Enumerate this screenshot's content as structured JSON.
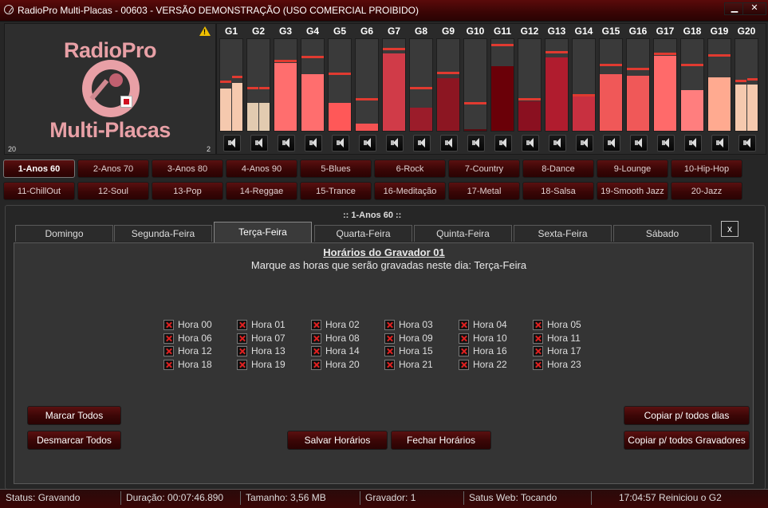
{
  "window": {
    "title": "RadioPro Multi-Placas - 00603 - VERSÃO DEMONSTRAÇÃO (USO COMERCIAL PROIBIDO)",
    "minimize": "▁",
    "close": "✕"
  },
  "logo": {
    "line1": "RadioPro",
    "line2": "Multi-Placas",
    "left_num": "20",
    "right_num": "2",
    "warn": "!"
  },
  "channels": [
    {
      "label": "G1",
      "level": 0.46,
      "peak": 0.52,
      "color": "#f5c9ae",
      "split": true,
      "level2": 0.52,
      "peak2": 0.57
    },
    {
      "label": "G2",
      "level": 0.3,
      "peak": 0.45,
      "color": "#e2cbb0",
      "split": true,
      "level2": 0.3,
      "peak2": 0.45
    },
    {
      "label": "G3",
      "level": 0.74,
      "peak": 0.75,
      "color": "#ff6e6e"
    },
    {
      "label": "G4",
      "level": 0.62,
      "peak": 0.79,
      "color": "#ff6e6e"
    },
    {
      "label": "G5",
      "level": 0.3,
      "peak": 0.61,
      "color": "#ff5858"
    },
    {
      "label": "G6",
      "level": 0.08,
      "peak": 0.33,
      "color": "#f55252"
    },
    {
      "label": "G7",
      "level": 0.84,
      "peak": 0.88,
      "color": "#d03b48"
    },
    {
      "label": "G8",
      "level": 0.25,
      "peak": 0.45,
      "color": "#9b1c2a"
    },
    {
      "label": "G9",
      "level": 0.57,
      "peak": 0.62,
      "color": "#8c1622"
    },
    {
      "label": "G10",
      "level": 0.02,
      "peak": 0.29,
      "color": "#5a0a10"
    },
    {
      "label": "G11",
      "level": 0.7,
      "peak": 0.92,
      "color": "#6a0008"
    },
    {
      "label": "G12",
      "level": 0.32,
      "peak": 0.33,
      "color": "#8a1020"
    },
    {
      "label": "G13",
      "level": 0.8,
      "peak": 0.84,
      "color": "#b01c2e"
    },
    {
      "label": "G14",
      "level": 0.37,
      "peak": 0.37,
      "color": "#c83040"
    },
    {
      "label": "G15",
      "level": 0.62,
      "peak": 0.7,
      "color": "#f05858"
    },
    {
      "label": "G16",
      "level": 0.6,
      "peak": 0.66,
      "color": "#f05858"
    },
    {
      "label": "G17",
      "level": 0.82,
      "peak": 0.83,
      "color": "#ff6a6a"
    },
    {
      "label": "G18",
      "level": 0.44,
      "peak": 0.7,
      "color": "#ff7e7e"
    },
    {
      "label": "G19",
      "level": 0.58,
      "peak": 0.81,
      "color": "#ffaa90"
    },
    {
      "label": "G20",
      "level": 0.5,
      "peak": 0.53,
      "color": "#f5c9ae",
      "split": true,
      "level2": 0.5,
      "peak2": 0.55
    }
  ],
  "presets_row1": [
    "1-Anos 60",
    "2-Anos 70",
    "3-Anos 80",
    "4-Anos 90",
    "5-Blues",
    "6-Rock",
    "7-Country",
    "8-Dance",
    "9-Lounge",
    "10-Hip-Hop"
  ],
  "presets_row2": [
    "11-ChillOut",
    "12-Soul",
    "13-Pop",
    "14-Reggae",
    "15-Trance",
    "16-Meditação",
    "17-Metal",
    "18-Salsa",
    "19-Smooth Jazz",
    "20-Jazz"
  ],
  "selected_preset": "1-Anos 60",
  "group_title": "::  1-Anos 60  ::",
  "tabs": [
    "Domingo",
    "Segunda-Feira",
    "Terça-Feira",
    "Quarta-Feira",
    "Quinta-Feira",
    "Sexta-Feira",
    "Sábado"
  ],
  "active_tab": "Terça-Feira",
  "close_x": "x",
  "scheduler": {
    "title": "Horários do Gravador 01",
    "subtitle": "Marque as horas que serão gravadas neste dia: Terça-Feira",
    "hours": [
      "Hora 00",
      "Hora 01",
      "Hora 02",
      "Hora 03",
      "Hora 04",
      "Hora 05",
      "Hora 06",
      "Hora 07",
      "Hora 08",
      "Hora 09",
      "Hora 10",
      "Hora 11",
      "Hora 12",
      "Hora 13",
      "Hora 14",
      "Hora 15",
      "Hora 16",
      "Hora 17",
      "Hora 18",
      "Hora 19",
      "Hora 20",
      "Hora 21",
      "Hora 22",
      "Hora 23"
    ]
  },
  "buttons": {
    "mark_all": "Marcar Todos",
    "unmark_all": "Desmarcar Todos",
    "save": "Salvar Horários",
    "close": "Fechar Horários",
    "copy_days": "Copiar p/ todos dias",
    "copy_recorders": "Copiar p/ todos Gravadores"
  },
  "status": {
    "status": "Status: Gravando",
    "duration": "Duração: 00:07:46.890",
    "size": "Tamanho: 3,56 MB",
    "recorder": "Gravador: 1",
    "web": "Satus Web: Tocando",
    "message": "17:04:57 Reiniciou o G2"
  }
}
